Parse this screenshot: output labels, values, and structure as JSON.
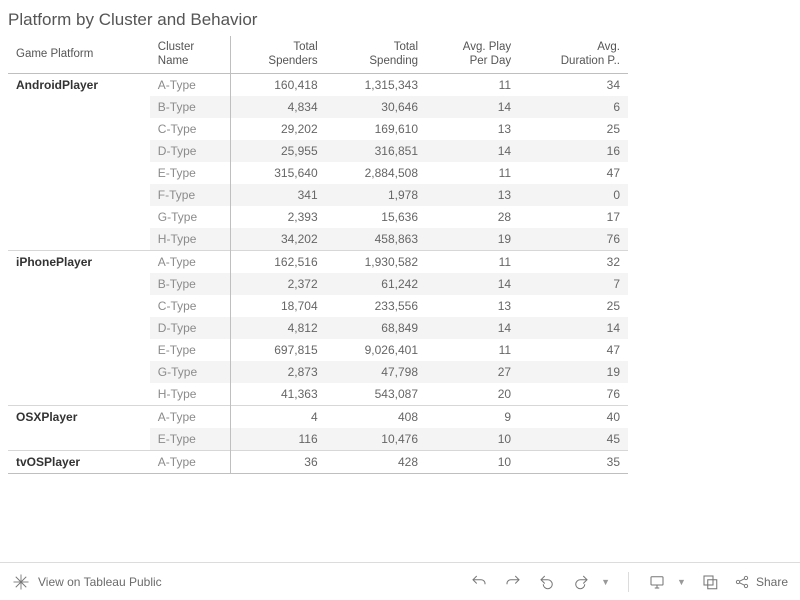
{
  "chart_data": {
    "type": "table",
    "title": "Platform by Cluster and Behavior",
    "columns": [
      "Game Platform",
      "Cluster Name",
      "Total Spenders",
      "Total Spending",
      "Avg. Play Per Day",
      "Avg. Duration P.."
    ],
    "rows": [
      {
        "platform": "AndroidPlayer",
        "cluster": "A-Type",
        "spenders": 160418,
        "spending": 1315343,
        "play_per_day": 11,
        "duration": 34
      },
      {
        "platform": "AndroidPlayer",
        "cluster": "B-Type",
        "spenders": 4834,
        "spending": 30646,
        "play_per_day": 14,
        "duration": 6
      },
      {
        "platform": "AndroidPlayer",
        "cluster": "C-Type",
        "spenders": 29202,
        "spending": 169610,
        "play_per_day": 13,
        "duration": 25
      },
      {
        "platform": "AndroidPlayer",
        "cluster": "D-Type",
        "spenders": 25955,
        "spending": 316851,
        "play_per_day": 14,
        "duration": 16
      },
      {
        "platform": "AndroidPlayer",
        "cluster": "E-Type",
        "spenders": 315640,
        "spending": 2884508,
        "play_per_day": 11,
        "duration": 47
      },
      {
        "platform": "AndroidPlayer",
        "cluster": "F-Type",
        "spenders": 341,
        "spending": 1978,
        "play_per_day": 13,
        "duration": 0
      },
      {
        "platform": "AndroidPlayer",
        "cluster": "G-Type",
        "spenders": 2393,
        "spending": 15636,
        "play_per_day": 28,
        "duration": 17
      },
      {
        "platform": "AndroidPlayer",
        "cluster": "H-Type",
        "spenders": 34202,
        "spending": 458863,
        "play_per_day": 19,
        "duration": 76
      },
      {
        "platform": "iPhonePlayer",
        "cluster": "A-Type",
        "spenders": 162516,
        "spending": 1930582,
        "play_per_day": 11,
        "duration": 32
      },
      {
        "platform": "iPhonePlayer",
        "cluster": "B-Type",
        "spenders": 2372,
        "spending": 61242,
        "play_per_day": 14,
        "duration": 7
      },
      {
        "platform": "iPhonePlayer",
        "cluster": "C-Type",
        "spenders": 18704,
        "spending": 233556,
        "play_per_day": 13,
        "duration": 25
      },
      {
        "platform": "iPhonePlayer",
        "cluster": "D-Type",
        "spenders": 4812,
        "spending": 68849,
        "play_per_day": 14,
        "duration": 14
      },
      {
        "platform": "iPhonePlayer",
        "cluster": "E-Type",
        "spenders": 697815,
        "spending": 9026401,
        "play_per_day": 11,
        "duration": 47
      },
      {
        "platform": "iPhonePlayer",
        "cluster": "G-Type",
        "spenders": 2873,
        "spending": 47798,
        "play_per_day": 27,
        "duration": 19
      },
      {
        "platform": "iPhonePlayer",
        "cluster": "H-Type",
        "spenders": 41363,
        "spending": 543087,
        "play_per_day": 20,
        "duration": 76
      },
      {
        "platform": "OSXPlayer",
        "cluster": "A-Type",
        "spenders": 4,
        "spending": 408,
        "play_per_day": 9,
        "duration": 40
      },
      {
        "platform": "OSXPlayer",
        "cluster": "E-Type",
        "spenders": 116,
        "spending": 10476,
        "play_per_day": 10,
        "duration": 45
      },
      {
        "platform": "tvOSPlayer",
        "cluster": "A-Type",
        "spenders": 36,
        "spending": 428,
        "play_per_day": 10,
        "duration": 35
      }
    ]
  },
  "headers": {
    "platform": {
      "l1": "",
      "l2": "Game Platform"
    },
    "cluster": {
      "l1": "Cluster",
      "l2": "Name"
    },
    "spenders": {
      "l1": "Total",
      "l2": "Spenders"
    },
    "spending": {
      "l1": "Total",
      "l2": "Spending"
    },
    "play": {
      "l1": "Avg. Play",
      "l2": "Per Day"
    },
    "duration": {
      "l1": "Avg.",
      "l2": "Duration P.."
    }
  },
  "toolbar": {
    "view_label": "View on Tableau Public",
    "share": "Share"
  }
}
